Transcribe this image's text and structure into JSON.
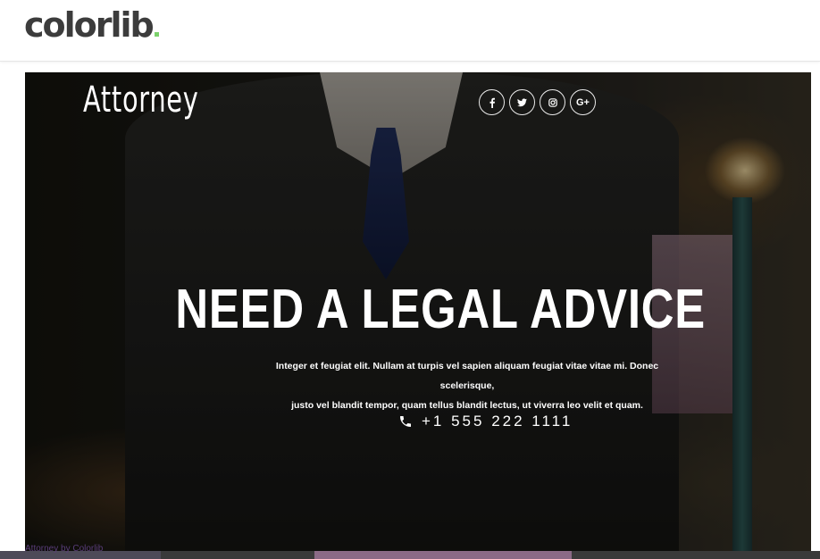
{
  "brand": {
    "name": "colorlib",
    "dot_color": "#7bd16b"
  },
  "hero": {
    "logo": "Attorney",
    "social": [
      {
        "icon": "facebook-icon",
        "glyph": "f"
      },
      {
        "icon": "twitter-icon",
        "glyph": "t"
      },
      {
        "icon": "instagram-icon",
        "glyph": "◎"
      },
      {
        "icon": "google-plus-icon",
        "glyph": "G+"
      }
    ],
    "headline": "NEED A LEGAL ADVICE",
    "description_line1": "Integer et feugiat elit. Nullam at turpis vel sapien aliquam feugiat vitae vitae mi. Donec scelerisque,",
    "description_line2": "justo vel blandit tempor, quam tellus blandit lectus, ut viverra leo velit et quam.",
    "phone": "+1 555 222 1111"
  },
  "footer_strip": {
    "text": "Attorney by Colorlib"
  }
}
